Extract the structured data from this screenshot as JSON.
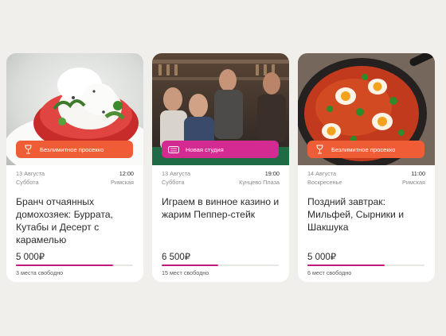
{
  "cards": [
    {
      "badge": "Безлимитное просекко",
      "badge_icon": "wine-glass-icon",
      "badge_color": "#ee5d35",
      "date": "13 Августа",
      "weekday": "Суббота",
      "time": "12:00",
      "location": "Римская",
      "title": "Бранч отчаянных домохозяек: Буррата, Кутабы и Десерт с карамелью",
      "price": "5 000₽",
      "seats": "3 места свободно",
      "fill_fraction": 0.83
    },
    {
      "badge": "Новая студия",
      "badge_icon": "new-tag-icon",
      "badge_color": "#d42b92",
      "date": "13 Августа",
      "weekday": "Суббота",
      "time": "19:00",
      "location": "Кунцево Плаза",
      "title": "Играем в винное казино и жарим Пеппер-стейк",
      "price": "6 500₽",
      "seats": "15 мест свободно",
      "fill_fraction": 0.48
    },
    {
      "badge": "Безлимитное просекко",
      "badge_icon": "wine-glass-icon",
      "badge_color": "#ee5d35",
      "date": "14 Августа",
      "weekday": "Воскресенье",
      "time": "11:00",
      "location": "Римская",
      "title": "Поздний завтрак: Мильфей, Сырники и Шакшука",
      "price": "5 000₽",
      "seats": "6 мест свободно",
      "fill_fraction": 0.66
    }
  ]
}
